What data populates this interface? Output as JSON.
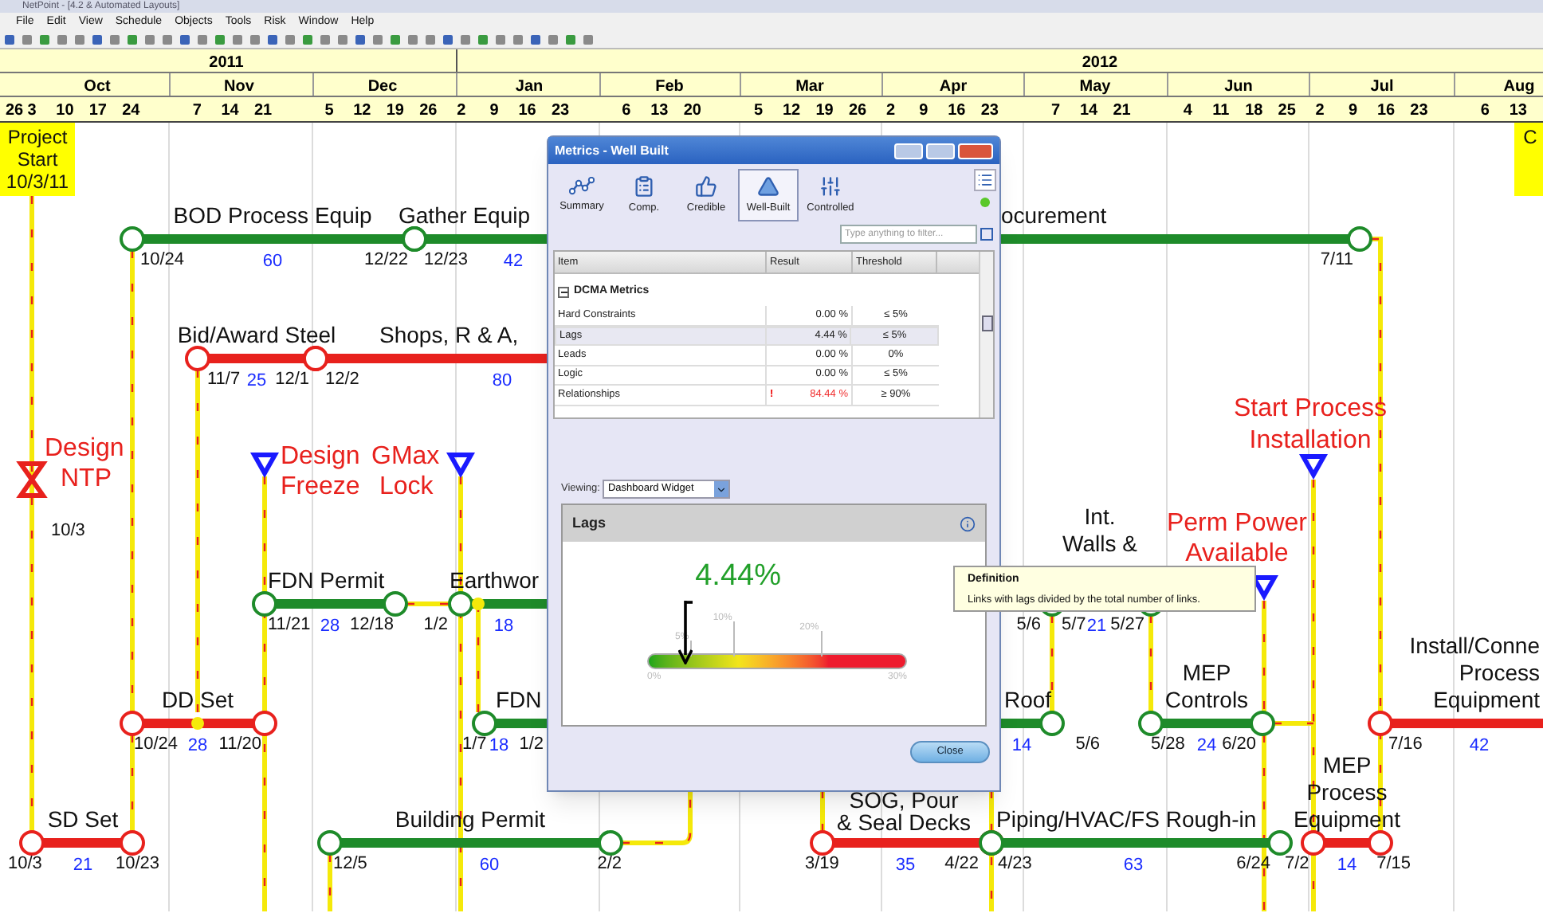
{
  "window": {
    "title": "NetPoint - [4.2 & Automated Layouts]"
  },
  "menu": [
    "File",
    "Edit",
    "View",
    "Schedule",
    "Objects",
    "Tools",
    "Risk",
    "Window",
    "Help"
  ],
  "timeline": {
    "years": [
      "2011",
      "2012"
    ],
    "months": [
      "Oct",
      "Nov",
      "Dec",
      "Jan",
      "Feb",
      "Mar",
      "Apr",
      "May",
      "Jun",
      "Jul",
      "Aug"
    ],
    "days": [
      "26",
      "3",
      "10",
      "17",
      "24",
      "7",
      "14",
      "21",
      "5",
      "12",
      "19",
      "26",
      "2",
      "9",
      "16",
      "23",
      "6",
      "13",
      "20",
      "5",
      "12",
      "19",
      "26",
      "2",
      "9",
      "16",
      "23",
      "7",
      "14",
      "21",
      "4",
      "11",
      "18",
      "25",
      "2",
      "9",
      "16",
      "23",
      "6",
      "13"
    ]
  },
  "activities": [
    {
      "label": [
        "BOD Process Equip"
      ],
      "critical": false,
      "start": "10/24",
      "duration": "60",
      "end": "12/22"
    },
    {
      "label": [
        "Gather Equip"
      ],
      "label_tail": "ocurement",
      "critical": false,
      "start": "12/23",
      "duration": "42",
      "end": "7/11"
    },
    {
      "label": [
        "Bid/Award Steel"
      ],
      "critical": true,
      "start": "11/7",
      "duration": "25",
      "end": "12/1"
    },
    {
      "label": [
        "Shops, R & A,"
      ],
      "critical": true,
      "start": "12/2",
      "duration": "80"
    },
    {
      "label": [
        "FDN Permit"
      ],
      "critical": false,
      "start": "11/21",
      "duration": "28",
      "end": "12/18"
    },
    {
      "label": [
        "Earthwor"
      ],
      "critical": false,
      "start": "1/2",
      "duration": "18"
    },
    {
      "label": [
        "DD Set"
      ],
      "critical": true,
      "start": "10/24",
      "duration": "28",
      "end": "11/20"
    },
    {
      "label": [
        "FDN"
      ],
      "critical": false,
      "start": "1/7",
      "duration": "18",
      "end": "1/2"
    },
    {
      "label": [
        "SD Set"
      ],
      "critical": true,
      "start": "10/3",
      "duration": "21",
      "end": "10/23"
    },
    {
      "label": [
        "Building Permit"
      ],
      "critical": false,
      "start": "12/5",
      "duration": "60",
      "end": "2/2"
    },
    {
      "label": [
        "Int.",
        "Walls &"
      ],
      "critical": false,
      "prior_end": "5/6",
      "start": "5/7",
      "duration": "21",
      "end": "5/27"
    },
    {
      "label": [
        "Roof"
      ],
      "critical": false,
      "duration": "14",
      "end": "5/6"
    },
    {
      "label": [
        "MEP",
        "Controls"
      ],
      "critical": false,
      "start": "5/28",
      "duration": "24",
      "end": "6/20"
    },
    {
      "label": [
        "Install/Conne",
        "Process",
        "Equipment"
      ],
      "critical": true,
      "start": "7/16",
      "duration": "42"
    },
    {
      "label": [
        "SOG, Pour",
        "& Seal Decks"
      ],
      "critical": true,
      "start": "3/19",
      "duration": "35",
      "end": "4/22"
    },
    {
      "label": [
        "Piping/HVAC/FS Rough-in"
      ],
      "critical": false,
      "start": "4/23",
      "duration": "63",
      "end": "6/24"
    },
    {
      "label": [
        "MEP",
        "Process",
        "Equipment"
      ],
      "critical": true,
      "start": "7/2",
      "duration": "14",
      "end": "7/15"
    }
  ],
  "milestones": [
    {
      "kind": "box",
      "label": [
        "Project",
        "Start",
        "10/3/11"
      ]
    },
    {
      "kind": "box",
      "label": [
        "C"
      ]
    },
    {
      "kind": "hourglass",
      "label": [
        "Design",
        "NTP"
      ],
      "date": "10/3"
    },
    {
      "kind": "triangle",
      "label": [
        "Design",
        "Freeze"
      ]
    },
    {
      "kind": "triangle",
      "label": [
        "GMax",
        "Lock"
      ]
    },
    {
      "kind": "triangle",
      "label": [
        "Start Process",
        "Installation"
      ]
    },
    {
      "kind": "triangle",
      "label": [
        "Perm Power",
        "Available"
      ]
    }
  ],
  "dialog": {
    "title": "Metrics - Well Built",
    "tabs": [
      {
        "kind": "summary",
        "label": "Summary",
        "selected": false
      },
      {
        "kind": "comp",
        "label": "Comp.",
        "selected": false
      },
      {
        "kind": "credible",
        "label": "Credible",
        "selected": false
      },
      {
        "kind": "wellbuilt",
        "label": "Well-Built",
        "selected": true
      },
      {
        "kind": "controlled",
        "label": "Controlled",
        "selected": false
      }
    ],
    "filter": {
      "placeholder": "Type anything to filter..."
    },
    "columns": [
      "Item",
      "Result",
      "Threshold"
    ],
    "group": "DCMA Metrics",
    "rows": [
      {
        "item": "Hard Constraints",
        "result": "0.00 %",
        "threshold": "≤ 5%",
        "failed": false,
        "selected": false
      },
      {
        "item": "Lags",
        "result": "4.44 %",
        "threshold": "≤ 5%",
        "failed": false,
        "selected": true
      },
      {
        "item": "Leads",
        "result": "0.00 %",
        "threshold": "0%",
        "failed": false,
        "selected": false
      },
      {
        "item": "Logic",
        "result": "0.00 %",
        "threshold": "≤ 5%",
        "failed": false,
        "selected": false
      },
      {
        "item": "Relationships",
        "result": "84.44 %",
        "threshold": "≥ 90%",
        "failed": true,
        "warning": "!",
        "selected": false
      }
    ],
    "viewing_label": "Viewing:",
    "viewing_value": "Dashboard Widget",
    "widget": {
      "title": "Lags",
      "value": "4.44%",
      "level": 0.148,
      "marks": [
        "5%",
        "10%",
        "20%"
      ],
      "min_label": "0%",
      "max_label": "30%"
    },
    "tooltip": {
      "title": "Definition",
      "text": "Links with lags divided by the total number of links."
    },
    "close": "Close"
  }
}
